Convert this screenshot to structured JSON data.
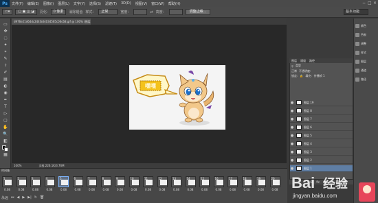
{
  "app": {
    "logo": "Ps",
    "window_controls": [
      "−",
      "□",
      "×"
    ]
  },
  "menu": [
    "文件(F)",
    "编辑(E)",
    "图像(I)",
    "图层(L)",
    "文字(Y)",
    "选择(S)",
    "滤镜(T)",
    "3D(D)",
    "视图(V)",
    "窗口(W)",
    "帮助(H)"
  ],
  "options": {
    "feather": "0 像素",
    "anti_alias": "消除锯齿",
    "style_label": "样式：",
    "style_value": "正常",
    "width_label": "宽度：",
    "height_label": "高度：",
    "refine_edge": "调整边缘...",
    "workspace": "基本功能"
  },
  "tools": [
    "▭",
    "✥",
    "◌",
    "✦",
    "⌖",
    "✎",
    "⚕",
    "✐",
    "▤",
    "◐",
    "◉",
    "✒",
    "T",
    "▷",
    "▢",
    "✋",
    "🔍",
    "◧",
    "⬛",
    "▦"
  ],
  "document": {
    "tab_title": "d976e21d64dc244fa04034565c06c68.gif @ 100% (图层 1, RGB/8)",
    "zoom": "100%",
    "doc_info": "文档:226.1K/3.76M"
  },
  "image": {
    "bubble_text": "嘿嘿",
    "subject": "cartoon-kitten"
  },
  "timeline": {
    "title": "时间轴",
    "frames": [
      {
        "n": "1",
        "delay": "0.08"
      },
      {
        "n": "2",
        "delay": "0.08"
      },
      {
        "n": "3",
        "delay": "0.08"
      },
      {
        "n": "4",
        "delay": "0.08"
      },
      {
        "n": "5",
        "delay": "0.08"
      },
      {
        "n": "6",
        "delay": "0.08"
      },
      {
        "n": "7",
        "delay": "0.08"
      },
      {
        "n": "8",
        "delay": "0.08"
      },
      {
        "n": "9",
        "delay": "0.08"
      },
      {
        "n": "10",
        "delay": "0.08"
      },
      {
        "n": "11",
        "delay": "0.08"
      },
      {
        "n": "12",
        "delay": "0.08"
      },
      {
        "n": "13",
        "delay": "0.08"
      },
      {
        "n": "14",
        "delay": "0.08"
      },
      {
        "n": "15",
        "delay": "0.08"
      },
      {
        "n": "16",
        "delay": "0.08"
      },
      {
        "n": "17",
        "delay": "0.08"
      },
      {
        "n": "18",
        "delay": "0.08"
      },
      {
        "n": "19",
        "delay": "0.08"
      },
      {
        "n": "20",
        "delay": "0.08"
      }
    ],
    "selected_frame": 4,
    "loop": "永远",
    "controls": [
      "⏮",
      "◀",
      "▶",
      "▶|",
      "↻",
      "🗑"
    ]
  },
  "right_dock": [
    {
      "label": "颜色",
      "icon": "color-icon"
    },
    {
      "label": "色板",
      "icon": "swatches-icon"
    },
    {
      "label": "调整",
      "icon": "adjustments-icon"
    },
    {
      "label": "样式",
      "icon": "styles-icon"
    },
    {
      "label": "图层",
      "icon": "layers-icon"
    },
    {
      "label": "通道",
      "icon": "channels-icon"
    },
    {
      "label": "路径",
      "icon": "paths-icon"
    }
  ],
  "layers_panel": {
    "tabs": [
      "图层",
      "通道",
      "路径"
    ],
    "filter": "类型",
    "blend": "正常",
    "opacity_label": "不透明度:",
    "lock_label": "锁定:",
    "fill_label": "填充:",
    "unify": "传播帧 1",
    "layers": [
      "图层 19",
      "图层 8",
      "图层 7",
      "图层 6",
      "图层 5",
      "图层 4",
      "图层 3",
      "图层 2",
      "图层 1"
    ],
    "selected_layer": 8,
    "footer": [
      "⊖",
      "fx",
      "◑",
      "▭",
      "▤",
      "🗑"
    ]
  },
  "watermark": {
    "brand": "Bai",
    "brand2": "经验",
    "url": "jingyan.baidu.com"
  },
  "colors": {
    "accent": "#5f7ea4",
    "bg": "#282828",
    "panel": "#535353"
  }
}
